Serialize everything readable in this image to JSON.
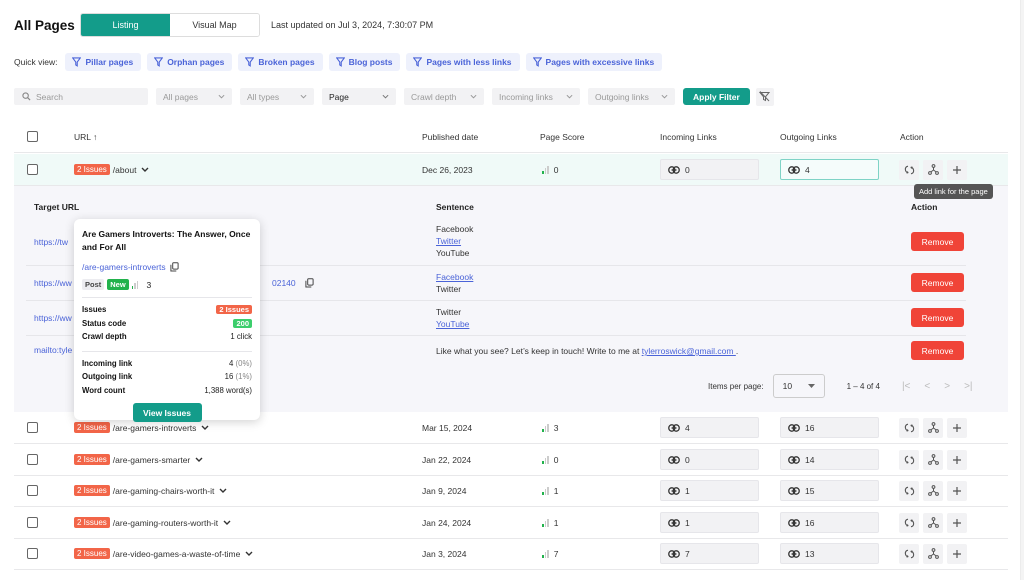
{
  "header": {
    "title": "All Pages",
    "tabs": [
      {
        "label": "Listing",
        "active": true
      },
      {
        "label": "Visual Map",
        "active": false
      }
    ],
    "last_updated": "Last updated on Jul 3, 2024, 7:30:07 PM"
  },
  "quick_view": {
    "label": "Quick view:",
    "chips": [
      "Pillar pages",
      "Orphan pages",
      "Broken pages",
      "Blog posts",
      "Pages with less links",
      "Pages with excessive links"
    ]
  },
  "filters": {
    "search_placeholder": "Search",
    "selects": [
      "All pages",
      "All types",
      "Page",
      "Crawl depth",
      "Incoming links",
      "Outgoing links"
    ],
    "apply_label": "Apply Filter"
  },
  "table": {
    "columns": {
      "url": "URL ↑",
      "published": "Published date",
      "score": "Page Score",
      "incoming": "Incoming Links",
      "outgoing": "Outgoing Links",
      "action": "Action"
    },
    "rows": [
      {
        "issues": "2 Issues",
        "url": "/about",
        "published": "Dec 26, 2023",
        "score": "0",
        "incoming": "0",
        "outgoing": "4"
      },
      {
        "issues": "2 Issues",
        "url": "/are-gamers-introverts",
        "published": "Mar 15, 2024",
        "score": "3",
        "incoming": "4",
        "outgoing": "16"
      },
      {
        "issues": "2 Issues",
        "url": "/are-gamers-smarter",
        "published": "Jan 22, 2024",
        "score": "0",
        "incoming": "0",
        "outgoing": "14"
      },
      {
        "issues": "2 Issues",
        "url": "/are-gaming-chairs-worth-it",
        "published": "Jan 9, 2024",
        "score": "1",
        "incoming": "1",
        "outgoing": "15"
      },
      {
        "issues": "2 Issues",
        "url": "/are-gaming-routers-worth-it",
        "published": "Jan 24, 2024",
        "score": "1",
        "incoming": "1",
        "outgoing": "16"
      },
      {
        "issues": "2 Issues",
        "url": "/are-video-games-a-waste-of-time",
        "published": "Jan 3, 2024",
        "score": "7",
        "incoming": "7",
        "outgoing": "13"
      }
    ],
    "action_tooltip": "Add link for the page"
  },
  "expanded": {
    "columns": {
      "target": "Target URL",
      "sentence": "Sentence",
      "action": "Action"
    },
    "rows": [
      {
        "target": "https://tw",
        "lines": [
          {
            "text": "Facebook",
            "link": false
          },
          {
            "text": "Twitter",
            "link": true
          },
          {
            "text": "YouTube",
            "link": false
          }
        ],
        "action": "Remove"
      },
      {
        "target": "https://ww",
        "target_suffix": "02140",
        "lines": [
          {
            "text": "Facebook",
            "link": true
          },
          {
            "text": "Twitter",
            "link": false
          }
        ],
        "action": "Remove"
      },
      {
        "target": "https://ww",
        "lines": [
          {
            "text": "Twitter",
            "link": false
          },
          {
            "text": "YouTube",
            "link": true
          }
        ],
        "action": "Remove"
      },
      {
        "target": "mailto:tyle",
        "sentence_prefix": "Like what you see? Let’s keep in touch! Write to me at ",
        "sentence_link": "tylerroswick@gmail.com ",
        "sentence_suffix": ".",
        "action": "Remove"
      }
    ],
    "pager": {
      "items_per_page_label": "Items per page:",
      "items_per_page": "10",
      "range": "1 – 4 of 4"
    }
  },
  "popup": {
    "title": "Are Gamers Introverts: The Answer, Once and For All",
    "slug": "/are-gamers-introverts",
    "type_tag": "Post",
    "new_tag": "New",
    "score": "3",
    "issues_label": "Issues",
    "issues_value": "2 Issues",
    "status_label": "Status code",
    "status_value": "200",
    "crawl_label": "Crawl depth",
    "crawl_value": "1 click",
    "incoming_label": "Incoming link",
    "incoming_value": "4",
    "incoming_pct": "(0%)",
    "outgoing_label": "Outgoing link",
    "outgoing_value": "16",
    "outgoing_pct": "(1%)",
    "words_label": "Word count",
    "words_value": "1,388 word(s)",
    "button": "View Issues"
  },
  "colors": {
    "accent": "#139c8a",
    "issues": "#f26548",
    "remove": "#f04438",
    "link": "#4a63d8"
  }
}
